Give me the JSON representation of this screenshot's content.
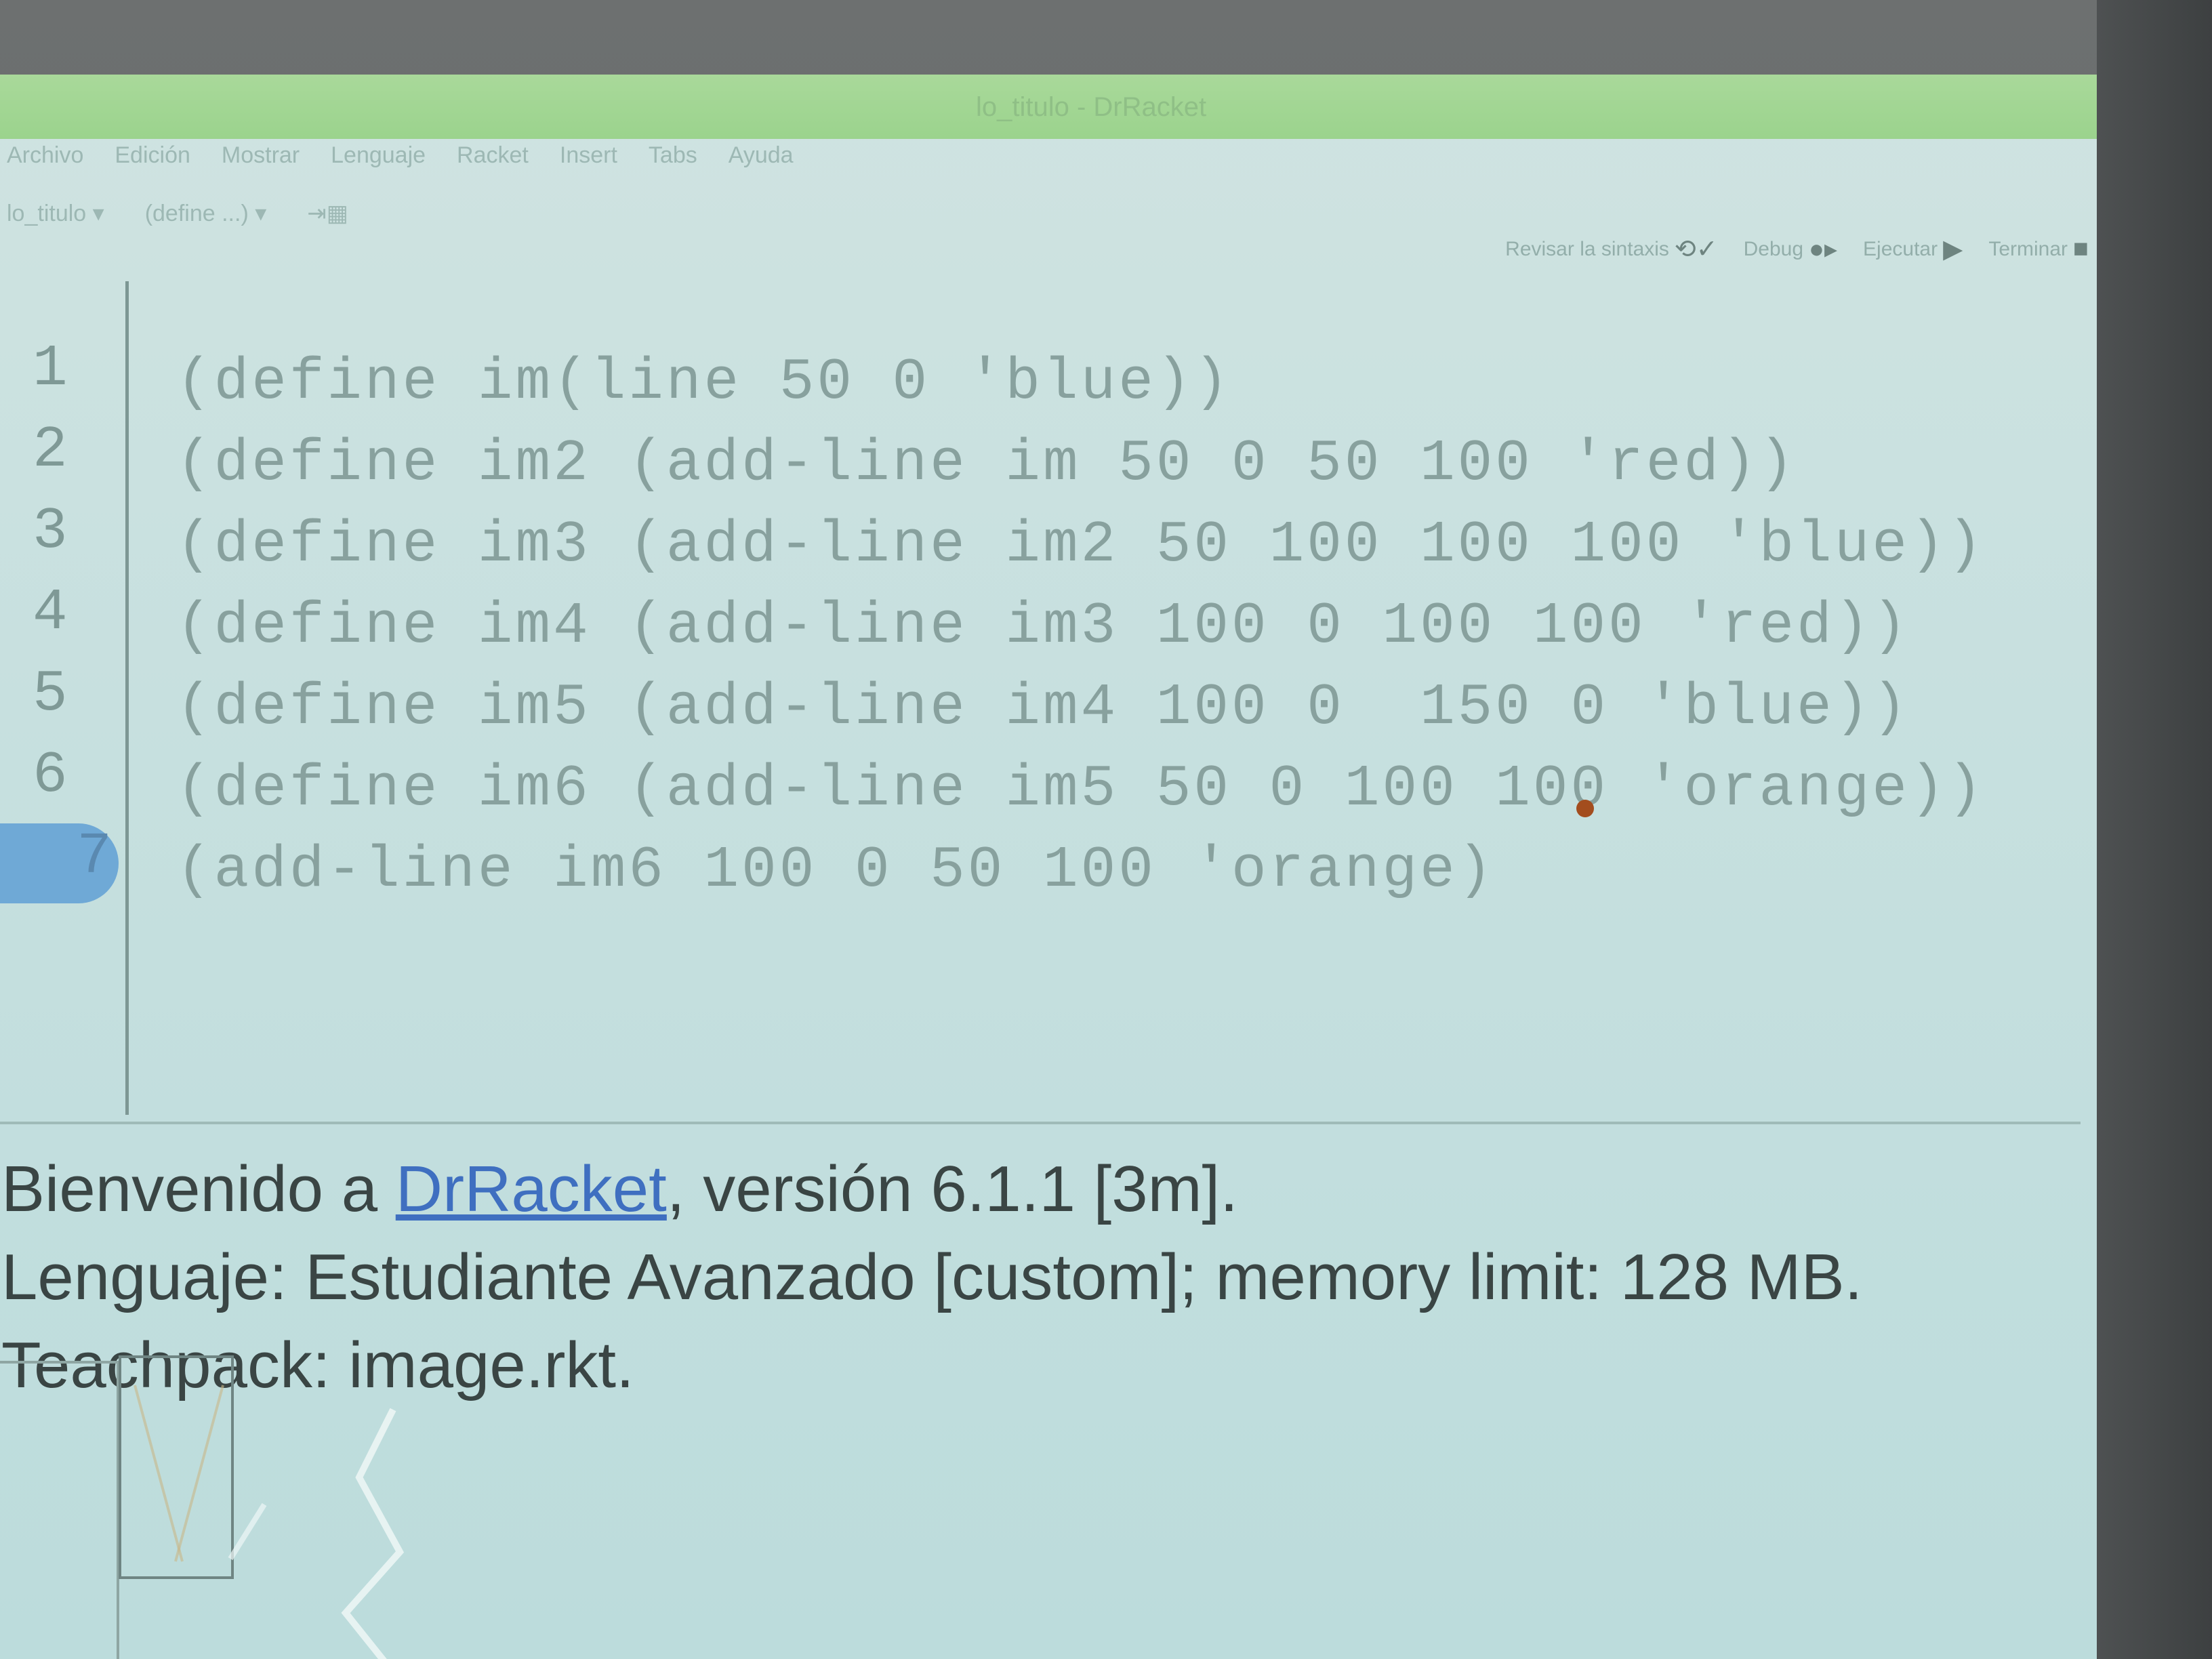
{
  "window": {
    "title": "lo_titulo - DrRacket"
  },
  "menubar": {
    "items": [
      "Archivo",
      "Edición",
      "Mostrar",
      "Lenguaje",
      "Racket",
      "Insert",
      "Tabs",
      "Ayuda"
    ]
  },
  "toolbar": {
    "left_items": [
      "lo_titulo ▾",
      "(define ...) ▾"
    ],
    "buttons": [
      {
        "label": "Revisar la sintaxis",
        "icon": "check-syntax-icon"
      },
      {
        "label": "Debug",
        "icon": "debug-icon"
      },
      {
        "label": "Ejecutar",
        "icon": "run-icon"
      },
      {
        "label": "Terminar",
        "icon": "stop-icon"
      }
    ]
  },
  "editor": {
    "line_numbers": [
      "1",
      "2",
      "3",
      "4",
      "5",
      "6",
      "7"
    ],
    "current_line": 7,
    "lines": [
      "(define im(line 50 0 'blue))",
      "(define im2 (add-line im 50 0 50 100 'red))",
      "(define im3 (add-line im2 50 100 100 100 'blue))",
      "(define im4 (add-line im3 100 0 100 100 'red))",
      "(define im5 (add-line im4 100 0  150 0 'blue))",
      "(define im6 (add-line im5 50 0 100 100 'orange))",
      "(add-line im6 100 0 50 100 'orange)"
    ]
  },
  "repl": {
    "welcome_prefix": "Bienvenido a ",
    "welcome_link": "DrRacket",
    "welcome_suffix": ", versión 6.1.1 [3m].",
    "language_line": "Lenguaje: Estudiante Avanzado [custom]; memory limit: 128 MB.",
    "teachpack_line": "Teachpack: image.rkt."
  },
  "colors": {
    "screen_bg": "#c7e0df",
    "titlebar": "#9bd38d",
    "code_text": "#88a19e",
    "current_line_highlight": "#6fa9d6",
    "link": "#3f6fc0"
  }
}
